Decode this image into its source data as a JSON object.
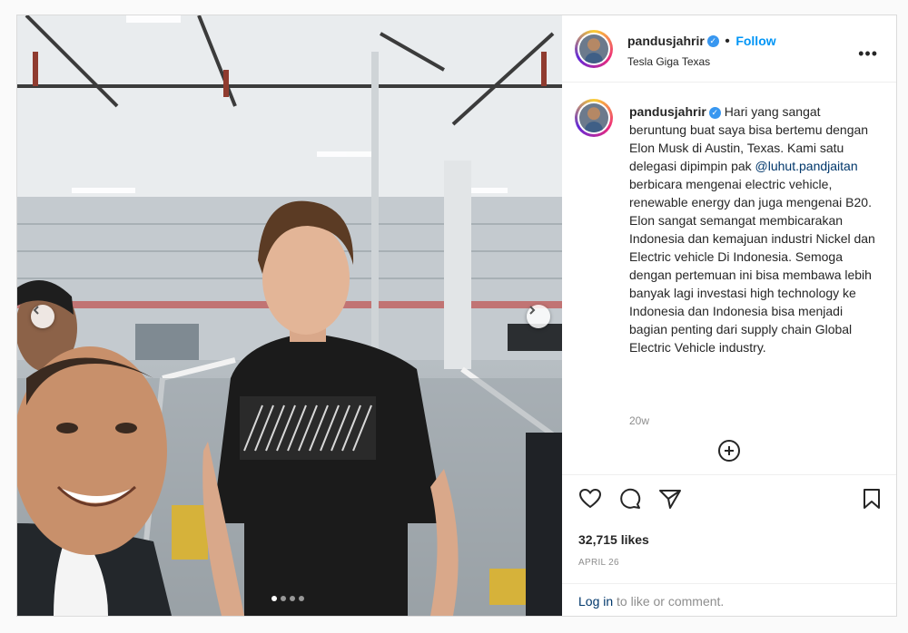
{
  "post": {
    "author": {
      "username": "pandusjahrir",
      "verified_mark": "✓",
      "follow_label": "Follow",
      "location": "Tesla Giga Texas",
      "avatar_icon": "profile-avatar"
    },
    "more_options_label": "•••",
    "caption": {
      "username": "pandusjahrir",
      "text_before_mention": "Hari yang sangat beruntung buat saya bisa bertemu dengan Elon Musk di Austin, Texas. Kami satu delegasi dipimpin pak ",
      "mention": "@luhut.pandjaitan",
      "text_after_mention": " berbicara mengenai electric vehicle, renewable energy dan juga mengenai B20. Elon sangat semangat membicarakan Indonesia dan kemajuan industri Nickel dan Electric vehicle Di Indonesia. Semoga dengan pertemuan ini bisa membawa lebih banyak lagi investasi high technology ke Indonesia dan Indonesia bisa menjadi bagian penting dari supply chain Global Electric Vehicle industry.",
      "time_ago": "20w"
    },
    "actions": {
      "icons": [
        "heart-icon",
        "comment-icon",
        "share-icon",
        "bookmark-icon"
      ]
    },
    "likes": "32,715 likes",
    "date": "APRIL 26",
    "footer": {
      "login_label": "Log in",
      "rest": " to like or comment."
    },
    "carousel": {
      "slide_count": 4,
      "active_index": 0
    },
    "colors": {
      "accent": "#0095f6",
      "verified": "#3897f0",
      "mention": "#00376b",
      "muted": "#8e8e8e"
    }
  }
}
